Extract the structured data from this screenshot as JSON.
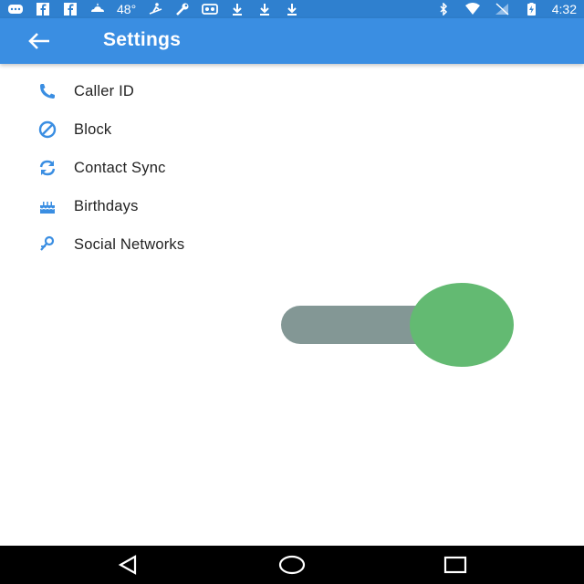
{
  "status_bar": {
    "temperature": "48°",
    "time": "4:32",
    "left_icons": [
      "message-icon",
      "facebook-icon",
      "facebook-icon",
      "weather-icon",
      "temperature-text",
      "ski-icon",
      "wrench-icon",
      "vr-icon",
      "download-icon",
      "download-icon",
      "download-icon"
    ],
    "right_icons": [
      "bluetooth-icon",
      "wifi-icon",
      "no-signal-icon",
      "battery-charging-icon"
    ]
  },
  "header": {
    "title": "Settings",
    "back_icon": "arrow-left-icon"
  },
  "menu": {
    "items": [
      {
        "label": "Caller ID",
        "icon": "phone-icon"
      },
      {
        "label": "Block",
        "icon": "block-icon"
      },
      {
        "label": "Contact Sync",
        "icon": "sync-icon"
      },
      {
        "label": "Birthdays",
        "icon": "cake-icon"
      },
      {
        "label": "Social Networks",
        "icon": "social-icon"
      }
    ]
  },
  "toggle": {
    "state": "on"
  },
  "colors": {
    "status_bar": "#2f80cf",
    "app_bar": "#3a8ee2",
    "icon_accent": "#3a8ee2",
    "toggle_track": "#839795",
    "toggle_thumb": "#63ba72",
    "nav_bar": "#000000"
  },
  "nav_bar": {
    "icons": [
      "back-triangle-icon",
      "home-circle-icon",
      "recents-square-icon"
    ]
  }
}
